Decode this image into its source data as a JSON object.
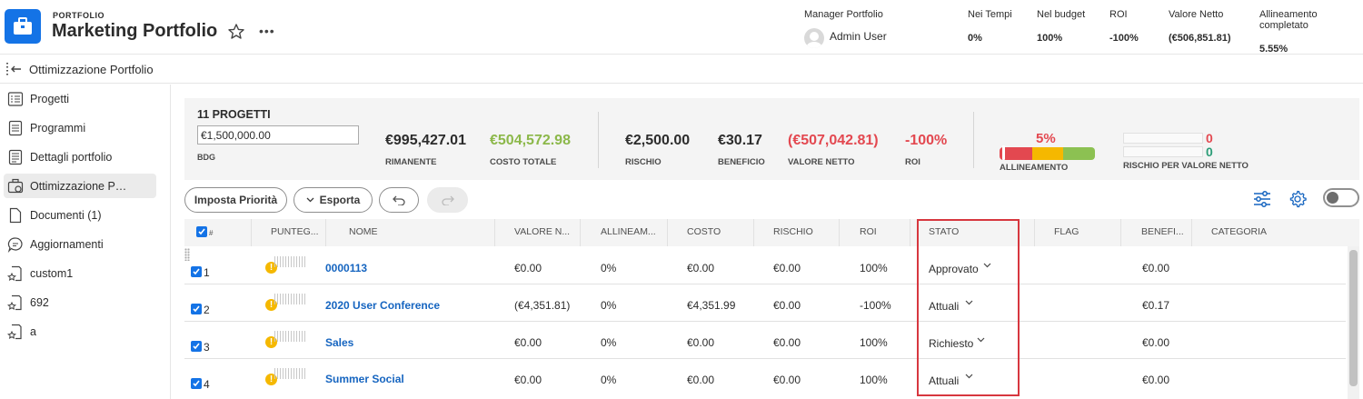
{
  "header": {
    "crumb": "PORTFOLIO",
    "title": "Marketing Portfolio",
    "manager_label": "Manager Portfolio",
    "manager_name": "Admin User",
    "kpis": [
      {
        "label": "Nei Tempi",
        "value": "0%"
      },
      {
        "label": "Nel budget",
        "value": "100%"
      },
      {
        "label": "ROI",
        "value": "-100%"
      },
      {
        "label": "Valore Netto",
        "value": "(€506,851.81)"
      },
      {
        "label": "Allineamento completato",
        "value": "5.55%"
      }
    ]
  },
  "subheader": {
    "title": "Ottimizzazione Portfolio"
  },
  "sidebar": {
    "items": [
      {
        "label": "Progetti",
        "icon": "projects-icon"
      },
      {
        "label": "Programmi",
        "icon": "programs-icon"
      },
      {
        "label": "Dettagli portfolio",
        "icon": "details-icon"
      },
      {
        "label": "Ottimizzazione Portfolio",
        "icon": "optimizer-icon",
        "active": true
      },
      {
        "label": "Documenti (1)",
        "icon": "document-icon"
      },
      {
        "label": "Aggiornamenti",
        "icon": "updates-icon"
      },
      {
        "label": "custom1",
        "icon": "custom-tab-icon"
      },
      {
        "label": "692",
        "icon": "custom-tab-icon"
      },
      {
        "label": "a",
        "icon": "custom-tab-icon"
      }
    ]
  },
  "summary": {
    "count": "11 PROGETTI",
    "budget_value": "€1,500,000.00",
    "budget_label": "BDG",
    "metrics": [
      {
        "value": "€995,427.01",
        "label": "RIMANENTE",
        "color": "#2c2c2c"
      },
      {
        "value": "€504,572.98",
        "label": "COSTO TOTALE",
        "color": "#8cb84a"
      },
      {
        "value": "€2,500.00",
        "label": "RISCHIO",
        "color": "#2c2c2c"
      },
      {
        "value": "€30.17",
        "label": "BENEFICIO",
        "color": "#2c2c2c"
      },
      {
        "value": "(€507,042.81)",
        "label": "VALORE NETTO",
        "color": "#e34850"
      },
      {
        "value": "-100%",
        "label": "ROI",
        "color": "#e34850"
      }
    ],
    "alignment_pct": "5%",
    "alignment_label": "ALLINEAMENTO",
    "risk_red": "0",
    "risk_green": "0",
    "risk_label": "RISCHIO PER VALORE NETTO"
  },
  "toolbar": {
    "priority_label": "Imposta Priorità",
    "export_label": "Esporta"
  },
  "table": {
    "headers": [
      "#",
      "PUNTEG...",
      "NOME",
      "VALORE N...",
      "ALLINEAM...",
      "COSTO",
      "RISCHIO",
      "ROI",
      "STATO",
      "FLAG",
      "BENEFI...",
      "CATEGORIA"
    ],
    "rows": [
      {
        "num": "1",
        "name": "0000113",
        "valore": "€0.00",
        "allineamento": "0%",
        "costo": "€0.00",
        "rischio": "€0.00",
        "roi": "100%",
        "stato": "Approvato",
        "beneficio": "€0.00"
      },
      {
        "num": "2",
        "name": "2020 User Conference",
        "valore": "(€4,351.81)",
        "allineamento": "0%",
        "costo": "€4,351.99",
        "rischio": "€0.00",
        "roi": "-100%",
        "stato": "Attuali",
        "beneficio": "€0.17"
      },
      {
        "num": "3",
        "name": "Sales",
        "valore": "€0.00",
        "allineamento": "0%",
        "costo": "€0.00",
        "rischio": "€0.00",
        "roi": "100%",
        "stato": "Richiesto",
        "beneficio": "€0.00"
      },
      {
        "num": "4",
        "name": "Summer Social",
        "valore": "€0.00",
        "allineamento": "0%",
        "costo": "€0.00",
        "rischio": "€0.00",
        "roi": "100%",
        "stato": "Attuali",
        "beneficio": "€0.00"
      }
    ]
  },
  "colors": {
    "brand": "#1473e6",
    "link": "#1665c0",
    "negative": "#e34850",
    "positive": "#8cb84a",
    "warning": "#f5b800",
    "highlight_border": "#d7373f"
  }
}
